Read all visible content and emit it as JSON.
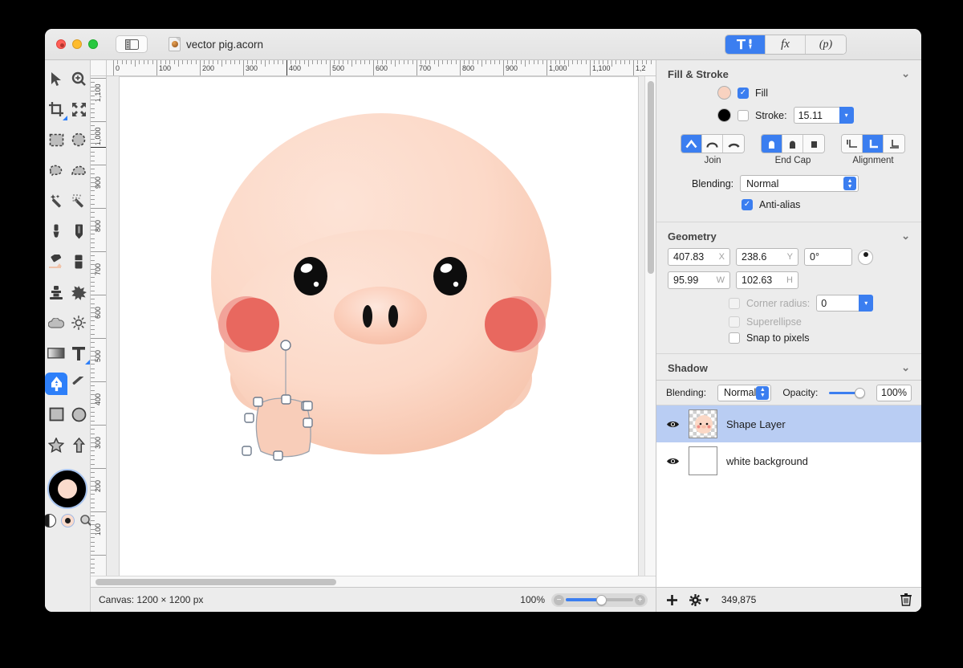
{
  "window": {
    "document_title": "vector pig.acorn",
    "traffic_lights": [
      "close-button",
      "minimize-button",
      "maximize-button"
    ]
  },
  "segmented_tabs": [
    {
      "id": "tools-tab",
      "label": "⚒",
      "active": true
    },
    {
      "id": "effects-tab",
      "label": "fx",
      "active": false
    },
    {
      "id": "path-tab",
      "label": "(p)",
      "active": false
    }
  ],
  "tools": [
    {
      "name": "move-tool",
      "label": "Move"
    },
    {
      "name": "zoom-tool",
      "label": "Zoom"
    },
    {
      "name": "crop-tool",
      "label": "Crop"
    },
    {
      "name": "transform-tool",
      "label": "Transform"
    },
    {
      "name": "rect-select-tool",
      "label": "Rectangular Select"
    },
    {
      "name": "ellipse-select-tool",
      "label": "Elliptical Select"
    },
    {
      "name": "lasso-tool",
      "label": "Lasso"
    },
    {
      "name": "polygon-lasso-tool",
      "label": "Polygon Lasso"
    },
    {
      "name": "magic-wand-tool",
      "label": "Magic Wand"
    },
    {
      "name": "instant-alpha-tool",
      "label": "Instant Alpha"
    },
    {
      "name": "brush-tool",
      "label": "Brush"
    },
    {
      "name": "pencil-tool",
      "label": "Pencil"
    },
    {
      "name": "paint-bucket-tool",
      "label": "Paint Bucket"
    },
    {
      "name": "eraser-tool",
      "label": "Eraser"
    },
    {
      "name": "clone-stamp-tool",
      "label": "Clone Stamp"
    },
    {
      "name": "smudge-tool",
      "label": "Smudge"
    },
    {
      "name": "blur-tool",
      "label": "Blur"
    },
    {
      "name": "dodge-tool",
      "label": "Dodge"
    },
    {
      "name": "gradient-tool",
      "label": "Gradient"
    },
    {
      "name": "text-tool",
      "label": "Text"
    },
    {
      "name": "bezier-pen-tool",
      "label": "Bezier Pen",
      "selected": true
    },
    {
      "name": "line-tool",
      "label": "Line"
    },
    {
      "name": "rectangle-shape-tool",
      "label": "Rectangle"
    },
    {
      "name": "ellipse-shape-tool",
      "label": "Ellipse"
    },
    {
      "name": "star-shape-tool",
      "label": "Star"
    },
    {
      "name": "arrow-shape-tool",
      "label": "Arrow"
    }
  ],
  "color_well": {
    "stroke_color": "#000000",
    "fill_color": "#fadbcc"
  },
  "ruler": {
    "horizontal_labels": [
      "0",
      "100",
      "200",
      "300",
      "400",
      "500",
      "600",
      "700",
      "800",
      "900",
      "1,000",
      "1,100",
      "1,2"
    ],
    "vertical_labels": [
      "1,100",
      "1,000",
      "900",
      "800",
      "700",
      "600",
      "500",
      "400",
      "300",
      "200",
      "100"
    ],
    "units": "px"
  },
  "inspector": {
    "fill_stroke": {
      "title": "Fill & Stroke",
      "fill_label": "Fill",
      "fill_checked": true,
      "fill_color": "#f8d2c0",
      "stroke_label": "Stroke:",
      "stroke_checked": false,
      "stroke_color": "#000000",
      "stroke_width": "15.11",
      "join_label": "Join",
      "join_options": [
        "miter-join",
        "round-join",
        "bevel-join"
      ],
      "join_selected": 0,
      "endcap_label": "End Cap",
      "endcap_options": [
        "butt-cap",
        "round-cap",
        "square-cap"
      ],
      "endcap_selected": 0,
      "alignment_label": "Alignment",
      "alignment_options": [
        "align-inside",
        "align-center",
        "align-outside"
      ],
      "alignment_selected": 1,
      "blending_label": "Blending:",
      "blending_value": "Normal",
      "antialias_label": "Anti-alias",
      "antialias_checked": true
    },
    "geometry": {
      "title": "Geometry",
      "x_value": "407.83",
      "x_label": "X",
      "y_value": "238.6",
      "y_label": "Y",
      "rotation_value": "0°",
      "w_value": "95.99",
      "w_label": "W",
      "h_value": "102.63",
      "h_label": "H",
      "corner_radius_label": "Corner radius:",
      "corner_radius_value": "0",
      "corner_radius_enabled": false,
      "superellipse_label": "Superellipse",
      "superellipse_enabled": false,
      "snap_to_pixels_label": "Snap to pixels",
      "snap_to_pixels_checked": false
    },
    "shadow": {
      "title": "Shadow"
    }
  },
  "layers_toolbar": {
    "blending_label": "Blending:",
    "blending_value": "Normal",
    "opacity_label": "Opacity:",
    "opacity_value": "100%"
  },
  "layers": [
    {
      "name": "Shape Layer",
      "visible": true,
      "selected": true,
      "thumb": "pig-thumbnail"
    },
    {
      "name": "white background",
      "visible": true,
      "selected": false,
      "thumb": "white-thumbnail"
    }
  ],
  "statusbar": {
    "canvas_label": "Canvas: 1200 × 1200 px",
    "zoom_level": "100%",
    "memory": "349,875",
    "add_layer_icon": "plus-icon",
    "settings_icon": "gear-icon",
    "delete_icon": "trash-icon"
  },
  "artwork": {
    "subject": "cartoon-pig",
    "body_color": "#fbd8c6",
    "cheek_color": "#e8685f",
    "eye_color": "#0d0d0d",
    "snout_color": "#f9c9b6",
    "selected_path_handles": 8
  },
  "colors": {
    "accent": "#3b7ef0",
    "window_bg": "#ececec",
    "panel_bg": "#ececec",
    "selection_blue": "#b9cdf3"
  }
}
